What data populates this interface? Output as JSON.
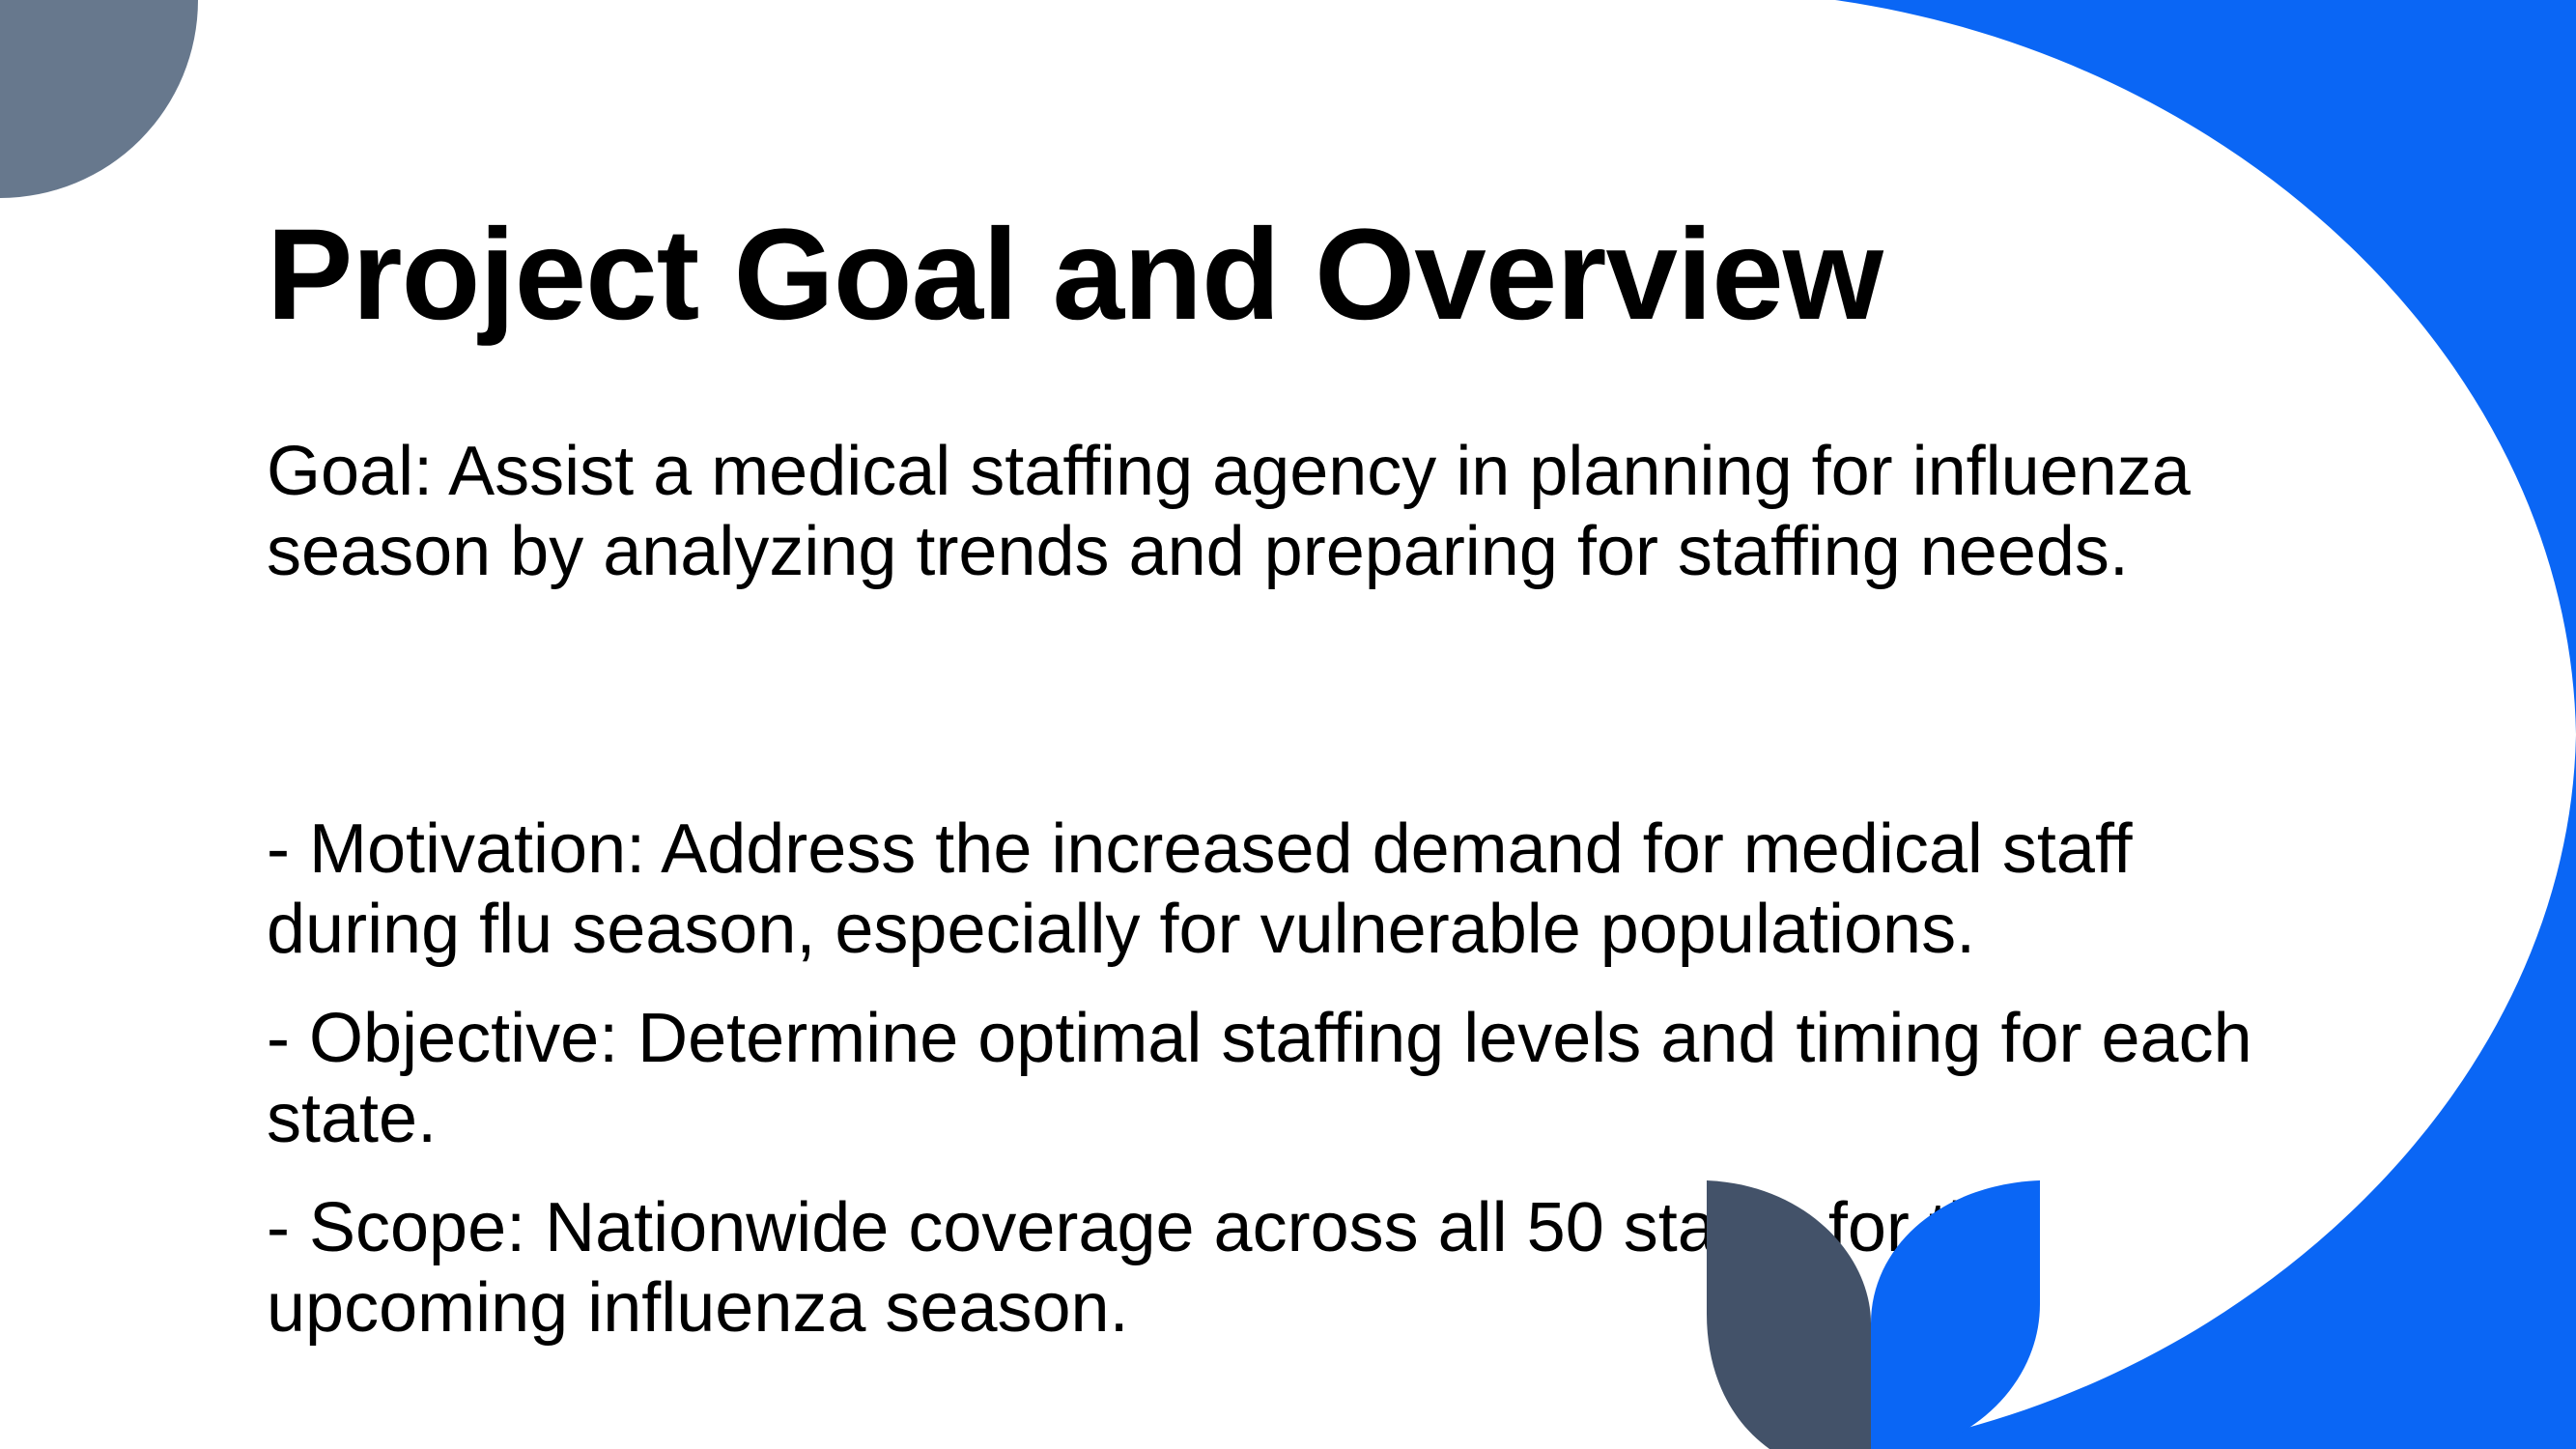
{
  "slide": {
    "title": "Project Goal and Overview",
    "goal": "Goal: Assist a medical staffing agency in planning for influenza season by analyzing trends and preparing for staffing needs.",
    "bullets": [
      "- Motivation: Address the increased demand for medical staff during flu season, especially for vulnerable populations.",
      "- Objective: Determine optimal staffing levels and timing for each state.",
      "- Scope: Nationwide coverage across all 50 states for the upcoming influenza season."
    ]
  },
  "colors": {
    "accent_blue": "#0a66f5",
    "slate": "#67788d",
    "dark_slate": "#435269",
    "text": "#000000",
    "background": "#ffffff"
  },
  "decorations": {
    "top_left_shape": "quarter-circle",
    "right_shape": "large-blue-arc",
    "bottom_leaves": "leaf-pair"
  }
}
